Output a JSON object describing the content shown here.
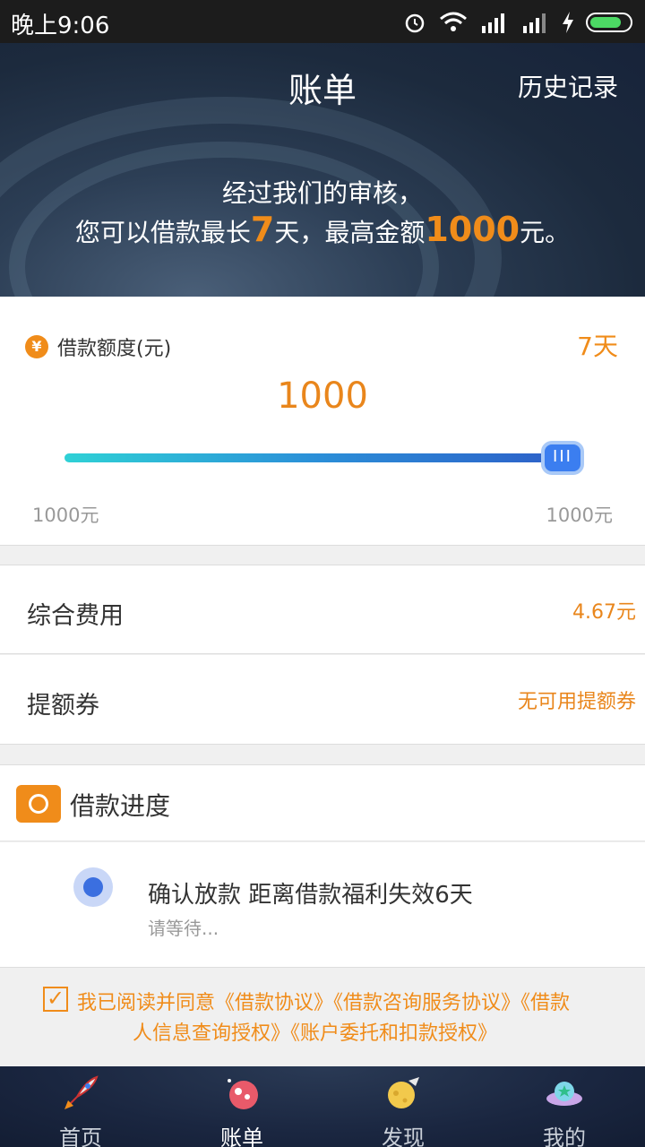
{
  "status_bar": {
    "time": "晚上9:06"
  },
  "header": {
    "title": "账单",
    "history": "历史记录"
  },
  "banner": {
    "line1": "经过我们的审核，",
    "line2_prefix": "您可以借款最长",
    "days": "7",
    "line2_mid": "天，最高金额",
    "amount": "1000",
    "line2_suffix": "元。"
  },
  "loan": {
    "label": "借款额度(元)",
    "days": "7天",
    "value": "1000",
    "min_label": "1000元",
    "max_label": "1000元",
    "slider_fraction": 1.0,
    "thumb_glyph": "III"
  },
  "rows": {
    "fee_label": "综合费用",
    "fee_value": "4.67元",
    "coupon_label": "提额券",
    "coupon_value": "无可用提额券"
  },
  "progress": {
    "title": "借款进度",
    "step_title": "确认放款 距离借款福利失效6天",
    "step_sub": "请等待..."
  },
  "agreement": {
    "line1": "我已阅读并同意《借款协议》《借款咨询服务协议》《借款",
    "line2": "人信息查询授权》《账户委托和扣款授权》",
    "checked": true
  },
  "nav": {
    "items": [
      {
        "label": "首页",
        "icon": "rocket-icon"
      },
      {
        "label": "账单",
        "icon": "planet-icon"
      },
      {
        "label": "发现",
        "icon": "moon-icon"
      },
      {
        "label": "我的",
        "icon": "ufo-icon"
      }
    ],
    "active_index": 1
  },
  "colors": {
    "accent": "#f08c1a",
    "primary_blue": "#3b7ef0"
  }
}
